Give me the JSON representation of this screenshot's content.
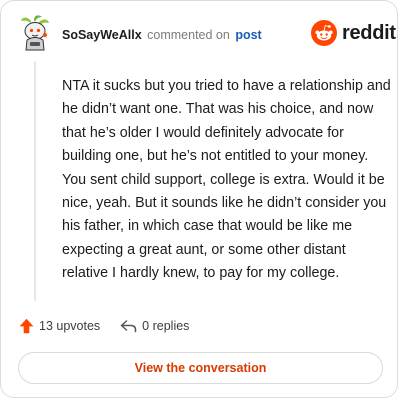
{
  "header": {
    "username": "SoSayWeAllx",
    "action": "commented on",
    "post_link": "post"
  },
  "brand": {
    "name": "reddit",
    "accent": "#FF4500"
  },
  "comment": {
    "body": "NTA it sucks but you tried to have a relationship and he didn’t want one. That was his choice, and now that he’s older I would definitely advocate for building one, but he’s not entitled to your money. You sent child support, college is extra. Would it be nice, yeah. But it sounds like he didn’t consider you his father, in which case that would be like me expecting a great aunt, or some other distant relative I hardly knew, to pay for my college."
  },
  "stats": {
    "upvotes": "13 upvotes",
    "replies": "0 replies"
  },
  "cta": {
    "label": "View the conversation"
  },
  "icons": {
    "avatar": "avatar-icon",
    "logo": "reddit-snoo-icon",
    "upvote": "upvote-arrow-icon",
    "reply": "reply-arrow-icon"
  }
}
